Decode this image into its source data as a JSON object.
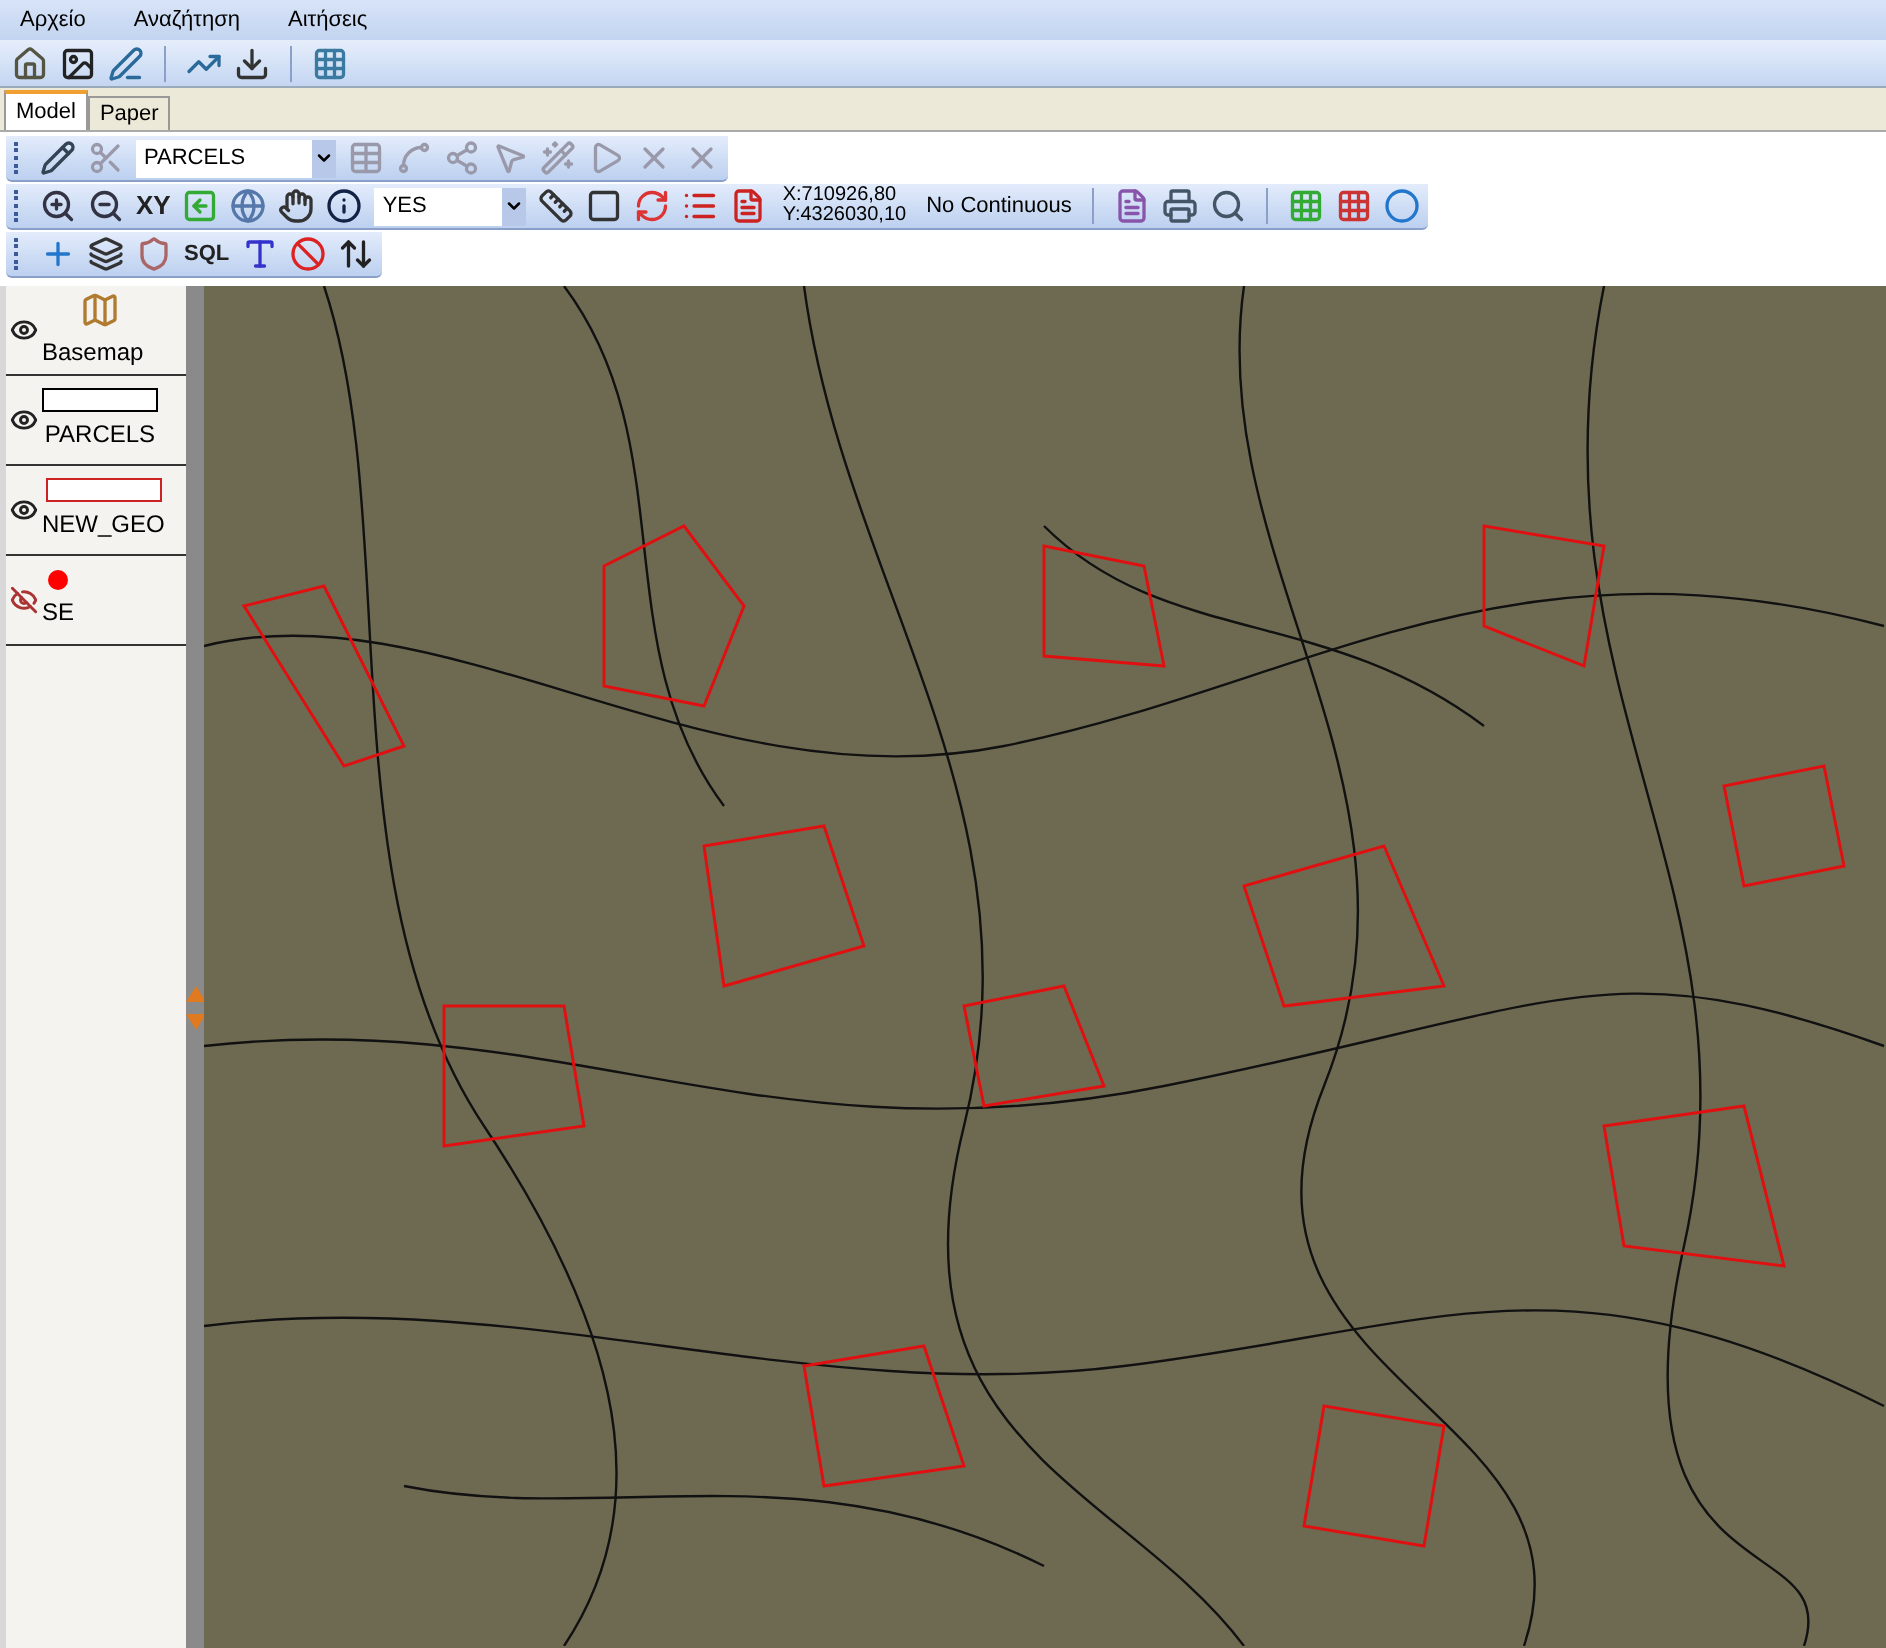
{
  "menu": [
    "Αρχείο",
    "Αναζήτηση",
    "Αιτήσεις"
  ],
  "tabs": [
    {
      "label": "Model",
      "selected": true
    },
    {
      "label": "Paper",
      "selected": false
    }
  ],
  "edit_toolbar": {
    "layer_select": {
      "value": "PARCELS"
    }
  },
  "view_toolbar": {
    "xy_button": "XY",
    "select": {
      "value": "YES"
    },
    "coordinates": [
      "X:710926,80",
      "Y:4326030,10"
    ],
    "mode": "No Continuous"
  },
  "layer_toolbar": {
    "sql_button": "SQL"
  },
  "layers": [
    {
      "name": "Basemap",
      "kind": "image",
      "visible": true
    },
    {
      "name": "PARCELS",
      "kind": "outline",
      "color": "#000000",
      "visible": true
    },
    {
      "name": "NEW_GEO",
      "kind": "outline",
      "color": "#cc2222",
      "visible": true
    },
    {
      "name": "SE",
      "kind": "point",
      "color": "#ff0000",
      "visible": false
    }
  ]
}
